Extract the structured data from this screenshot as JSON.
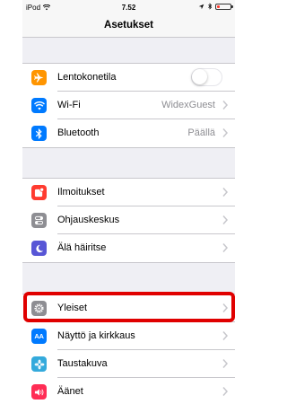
{
  "status_bar": {
    "carrier": "iPod",
    "time": "7.52"
  },
  "nav": {
    "title": "Asetukset"
  },
  "group1": [
    {
      "label": "Lentokonetila",
      "icon": "airplane-icon",
      "color": "#ff9500",
      "toggle": false
    },
    {
      "label": "Wi-Fi",
      "icon": "wifi-icon",
      "color": "#007aff",
      "value": "WidexGuest"
    },
    {
      "label": "Bluetooth",
      "icon": "bluetooth-icon",
      "color": "#007aff",
      "value": "Päällä"
    }
  ],
  "group2": [
    {
      "label": "Ilmoitukset",
      "icon": "notifications-icon",
      "color": "#ff3b30"
    },
    {
      "label": "Ohjauskeskus",
      "icon": "control-center-icon",
      "color": "#8e8e93"
    },
    {
      "label": "Älä häiritse",
      "icon": "moon-icon",
      "color": "#5856d6"
    }
  ],
  "group3": [
    {
      "label": "Yleiset",
      "icon": "gear-icon",
      "color": "#8e8e93"
    },
    {
      "label": "Näyttö ja kirkkaus",
      "icon": "display-icon",
      "color": "#007aff",
      "icon_text": "AA"
    },
    {
      "label": "Taustakuva",
      "icon": "wallpaper-icon",
      "color": "#34aadc"
    },
    {
      "label": "Äänet",
      "icon": "sounds-icon",
      "color": "#ff2d55"
    }
  ],
  "colors": {
    "highlight": "#e00000",
    "battery_low": "#ff3b30"
  }
}
